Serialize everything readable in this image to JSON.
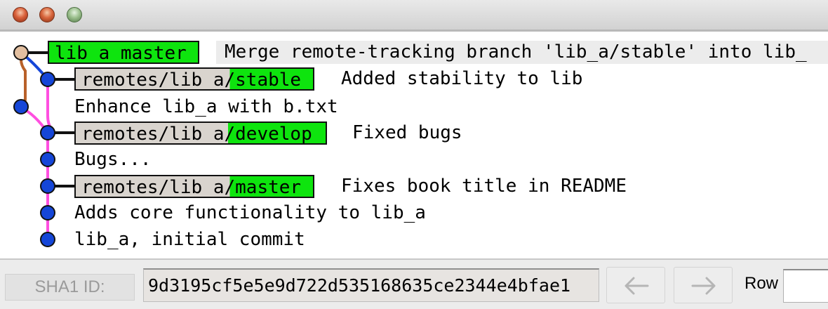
{
  "window": {
    "traffic_lights": [
      "close-button",
      "minimize-button",
      "zoom-button"
    ]
  },
  "history": {
    "rows": [
      {
        "ref_type": "local",
        "ref_remote": "",
        "ref_branch": "lib_a_master",
        "message": "Merge remote-tracking branch 'lib_a/stable' into lib_"
      },
      {
        "ref_type": "remote",
        "ref_remote": "remotes/lib_a/",
        "ref_branch": "stable",
        "message": "Added stability to lib"
      },
      {
        "ref_type": "",
        "ref_remote": "",
        "ref_branch": "",
        "message": "Enhance lib_a with b.txt"
      },
      {
        "ref_type": "remote",
        "ref_remote": "remotes/lib_a/",
        "ref_branch": "develop",
        "message": "Fixed bugs"
      },
      {
        "ref_type": "",
        "ref_remote": "",
        "ref_branch": "",
        "message": "Bugs..."
      },
      {
        "ref_type": "remote",
        "ref_remote": "remotes/lib_a/",
        "ref_branch": "master",
        "message": "Fixes book title in README"
      },
      {
        "ref_type": "",
        "ref_remote": "",
        "ref_branch": "",
        "message": "Adds core functionality to lib_a"
      },
      {
        "ref_type": "",
        "ref_remote": "",
        "ref_branch": "",
        "message": "lib_a, initial commit"
      }
    ]
  },
  "colors": {
    "branch_green": "#0ee40e",
    "remote_gray": "#d9d4ce",
    "commit_blue": "#1546d8",
    "head_commit": "#e2bfa0",
    "line_pink": "#ff4fe0",
    "line_brown": "#b8612a"
  },
  "footer": {
    "sha_label": "SHA1 ID:",
    "sha_value": "9d3195cf5e5e9d722d535168635ce2344e4bfae1",
    "back_icon": "left-arrow-icon",
    "forward_icon": "right-arrow-icon",
    "row_label": "Row",
    "row_value": ""
  }
}
